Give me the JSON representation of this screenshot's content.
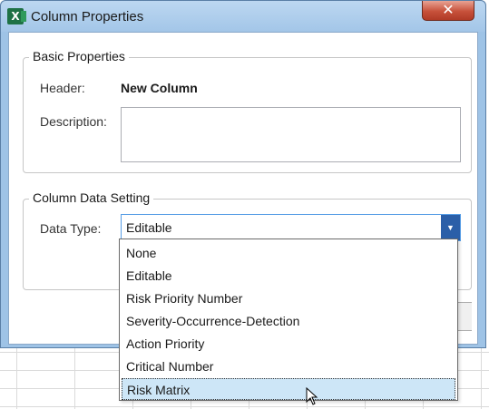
{
  "window": {
    "title": "Column Properties",
    "app_icon_letter": "X",
    "close_glyph": "✕"
  },
  "basic_properties": {
    "group_label": "Basic Properties",
    "header_label": "Header:",
    "header_value": "New Column",
    "description_label": "Description:",
    "description_value": ""
  },
  "column_data_setting": {
    "group_label": "Column Data Setting",
    "data_type_label": "Data Type:",
    "data_type_value": "Editable",
    "dropdown_arrow": "▼"
  },
  "dropdown": {
    "options": [
      "None",
      "Editable",
      "Risk Priority Number",
      "Severity-Occurrence-Detection",
      "Action Priority",
      "Critical Number",
      "Risk Matrix"
    ],
    "highlighted": "Risk Matrix"
  },
  "colors": {
    "title_bar": "#a3c6e8",
    "close_button": "#c7513b",
    "combo_button": "#2b5fa8",
    "highlight": "#cde6f7",
    "app_icon": "#1e7145"
  }
}
